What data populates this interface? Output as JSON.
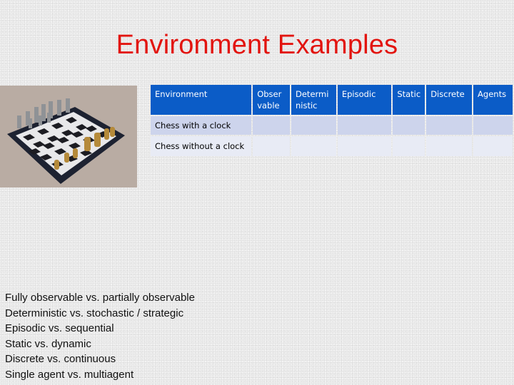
{
  "slide": {
    "title": "Environment Examples",
    "image": {
      "icon": "chess-board-image",
      "alt": "Chess set on board"
    }
  },
  "table": {
    "headers": [
      {
        "label": "Environment"
      },
      {
        "label": "Obser vable"
      },
      {
        "label": "Determi nistic"
      },
      {
        "label": "Episodic"
      },
      {
        "label": "Static"
      },
      {
        "label": "Discrete"
      },
      {
        "label": "Agents"
      }
    ],
    "rows": [
      {
        "cells": [
          "Chess with a clock",
          "",
          "",
          "",
          "",
          "",
          ""
        ]
      },
      {
        "cells": [
          "Chess without a clock",
          "",
          "",
          "",
          "",
          "",
          ""
        ]
      }
    ]
  },
  "properties": [
    "Fully observable vs. partially observable",
    "Deterministic vs. stochastic / strategic",
    "Episodic vs. sequential",
    "Static vs. dynamic",
    "Discrete vs. continuous",
    "Single agent vs. multiagent"
  ],
  "colors": {
    "title": "#e2140f",
    "header_bg": "#0b5cc7",
    "row_odd": "#cdd4ec",
    "row_even": "#e8ebf5"
  }
}
